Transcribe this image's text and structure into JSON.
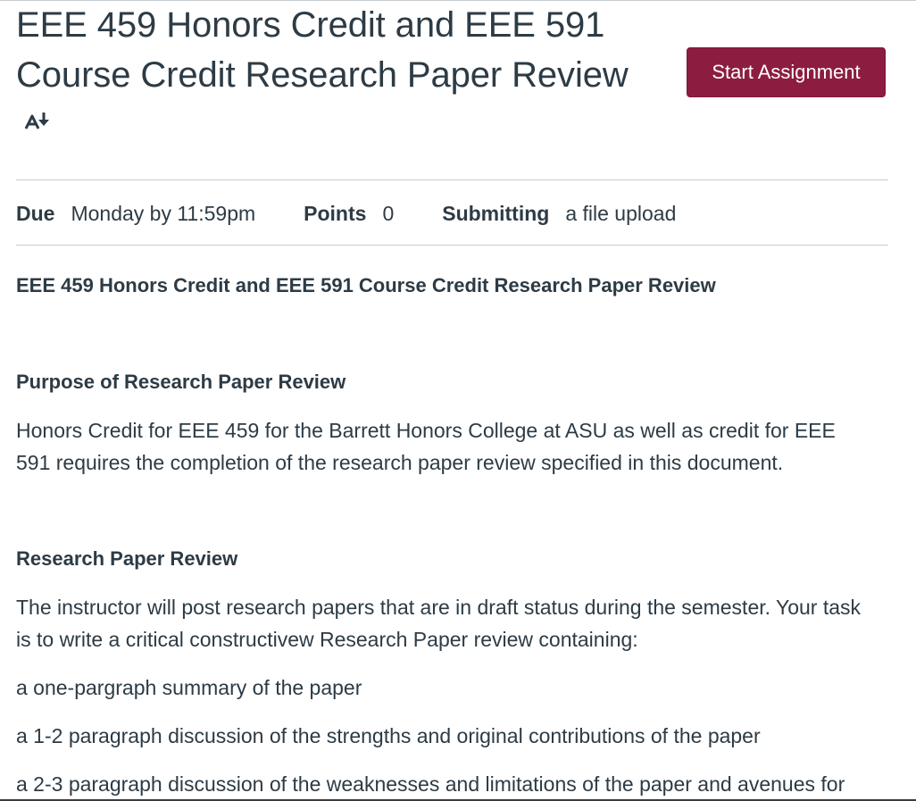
{
  "assignment": {
    "title": "EEE 459 Honors Credit and EEE 591 Course Credit Research Paper Review",
    "start_button_label": "Start Assignment",
    "immersive_reader_icon": "immersive-reader-icon"
  },
  "details": {
    "due_label": "Due",
    "due_value": "Monday by 11:59pm",
    "points_label": "Points",
    "points_value": "0",
    "submitting_label": "Submitting",
    "submitting_value": "a file upload"
  },
  "description": {
    "heading": "EEE 459 Honors Credit and EEE 591 Course Credit Research Paper Review",
    "purpose_heading": "Purpose of Research Paper Review",
    "purpose_text": "Honors Credit for EEE 459 for the Barrett Honors College at ASU as well as credit for EEE 591 requires the completion of the research paper review specified in this document.",
    "review_heading": "Research Paper Review",
    "review_text": "The instructor will post research papers that are in draft status during the semester. Your task is to write a critical constructivew Research Paper review containing:",
    "items": [
      "a one-pargraph summary of the paper",
      "a 1-2 paragraph discussion of the strengths and original contributions of the paper",
      "a 2-3 paragraph discussion of the weaknesses and limitations of the paper and avenues for"
    ]
  },
  "colors": {
    "accent": "#8c1d40",
    "text": "#2d3b45",
    "divider": "#c7cdd1"
  }
}
